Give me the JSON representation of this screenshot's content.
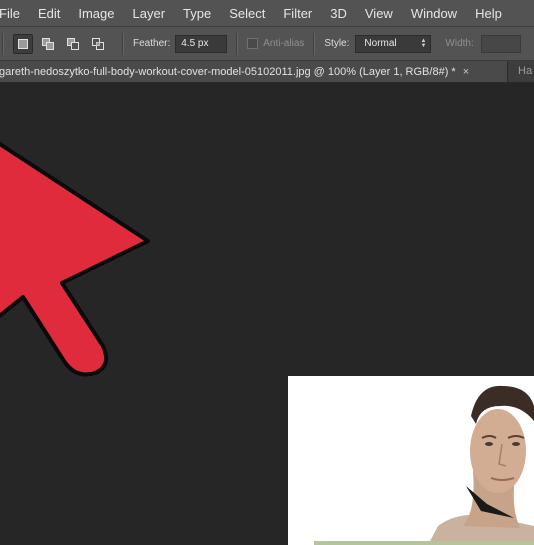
{
  "menu": {
    "items": [
      "File",
      "Edit",
      "Image",
      "Layer",
      "Type",
      "Select",
      "Filter",
      "3D",
      "View",
      "Window",
      "Help"
    ]
  },
  "options": {
    "feather_label": "Feather:",
    "feather_value": "4.5 px",
    "antialias_label": "Anti-alias",
    "style_label": "Style:",
    "style_value": "Normal",
    "width_label": "Width:"
  },
  "tabs": {
    "active_title": "gareth-nedoszytko-full-body-workout-cover-model-05102011.jpg @ 100% (Layer 1, RGB/8#) *",
    "close_glyph": "×",
    "second_title": "Ha"
  },
  "colors": {
    "arrow": "#e02b3c",
    "ui_panel": "#535353",
    "canvas": "#262626"
  }
}
